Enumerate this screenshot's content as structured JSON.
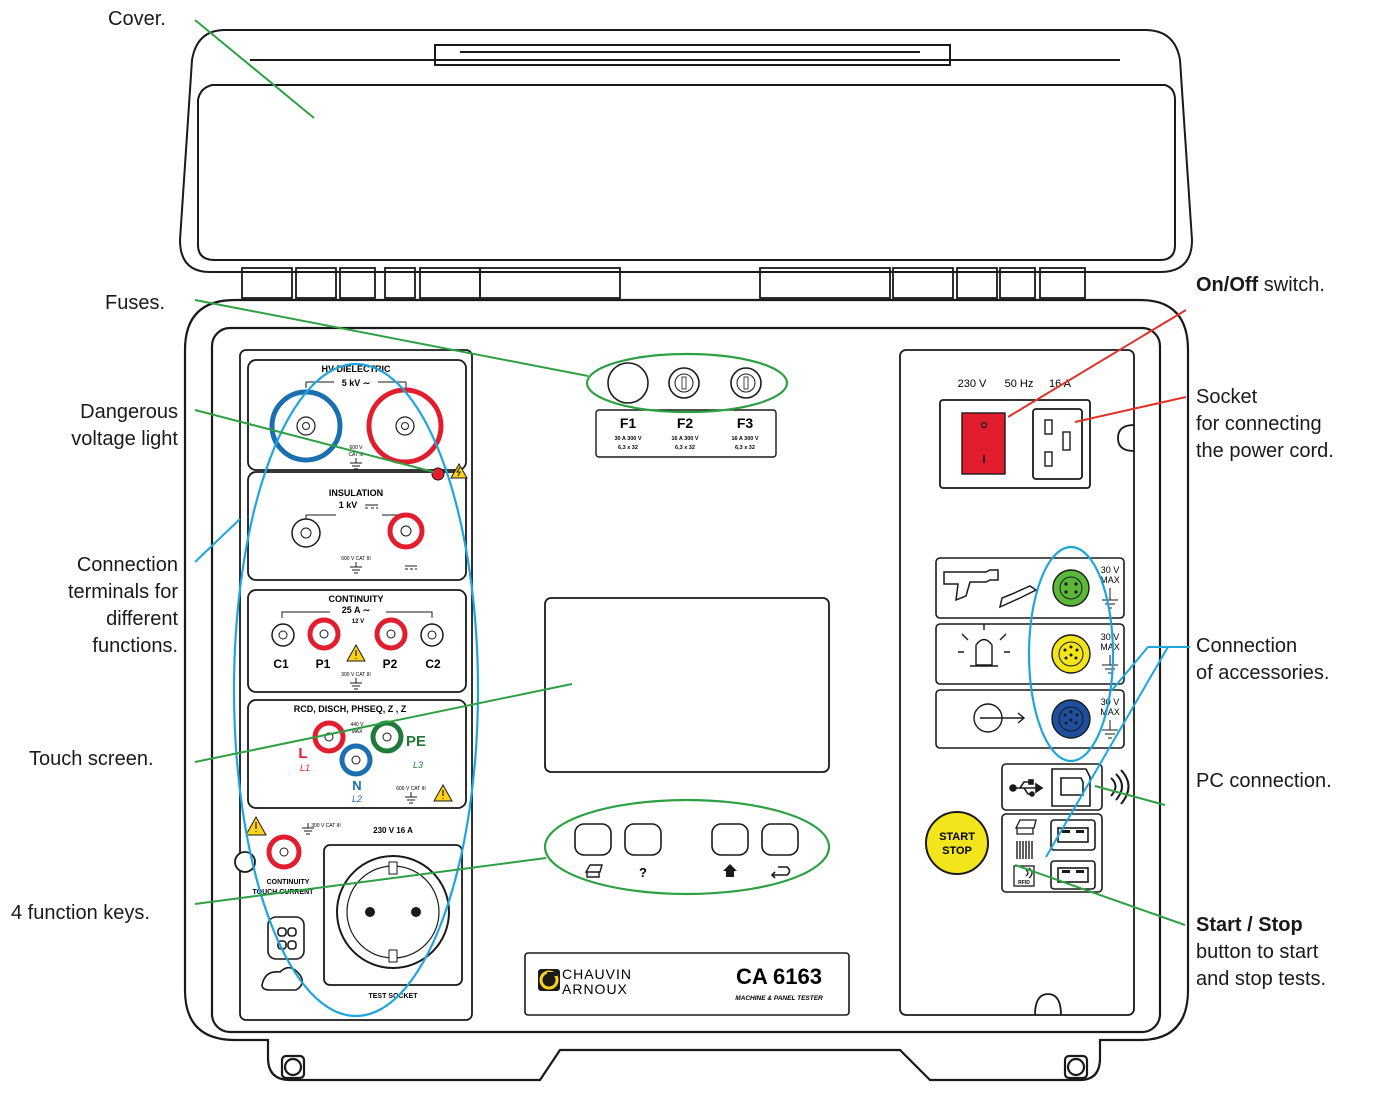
{
  "callouts": {
    "cover": "Cover.",
    "fuses": "Fuses.",
    "danger_1": "Dangerous",
    "danger_2": "voltage light",
    "terminals_1": "Connection",
    "terminals_2": "terminals for",
    "terminals_3": "different",
    "terminals_4": "functions.",
    "touch": "Touch screen.",
    "keys": "4 function keys.",
    "onoff_bold": "On/Off",
    "onoff_rest": " switch.",
    "socket_1": "Socket",
    "socket_2": "for connecting",
    "socket_3": "the power cord.",
    "acc_1": "Connection",
    "acc_2": "of accessories.",
    "pc": "PC connection.",
    "start_bold": "Start / Stop",
    "start_2": "button to start",
    "start_3": "and stop tests."
  },
  "panel": {
    "hv_title": "HV DIELECTRIC",
    "hv_sub": "5 kV ∼",
    "cat_600": "600 V",
    "cat_iii": "CAT III",
    "ins_title": "INSULATION",
    "ins_sub": "1 kV",
    "ins_cat": "600 V  CAT III",
    "cont_title": "CONTINUITY",
    "cont_sub": "25 A ∼",
    "cont_v": "12 V",
    "c1": "C1",
    "p1": "P1",
    "p2": "P2",
    "c2": "C2",
    "cont_cat": "300 V  CAT III",
    "rcd_title": "RCD, DISCH, PHSEQ, Z , Z",
    "rcd_max1": "440 V",
    "rcd_max2": "MAX",
    "l": "L",
    "l1": "L1",
    "n": "N",
    "l2": "L2",
    "pe": "PE",
    "l3": "L3",
    "rcd_cat": "600 V  CAT III",
    "ts_cat": "300 V  CAT III",
    "ts_rating": "230 V 16 A",
    "ts_cont1": "CONTINUITY",
    "ts_cont2": "TOUCH CURRENT",
    "test_socket": "TEST SOCKET",
    "f1": "F1",
    "f2": "F2",
    "f3": "F3",
    "f1_rating": "30 A  300 V",
    "f2_rating": "16 A  300 V",
    "f3_rating": "16 A  300 V",
    "fuse_size": "6,3 x 32",
    "key_help": "?",
    "brand_1": "CHAUVIN",
    "brand_2": "ARNOUX",
    "model": "CA 6163",
    "model_sub": "MACHINE & PANEL TESTER",
    "mains_v": "230 V",
    "mains_hz": "50 Hz",
    "mains_a": "16 A",
    "acc_v": "30 V",
    "acc_max": "MAX",
    "start": "START",
    "stop": "STOP",
    "rfid": "RFID"
  },
  "colors": {
    "outline": "#1a1a1a",
    "callout_green": "#2ea043",
    "callout_red": "#e0332b",
    "callout_blue": "#1ea6dc",
    "terminal_red": "#e11d2e",
    "terminal_blue": "#1a6fb0",
    "terminal_green": "#1f7a3a",
    "switch_red": "#e11d2e",
    "conn_green": "#5cb83a",
    "conn_yellow": "#f2e51b",
    "conn_blue": "#1d4f9e",
    "start_yellow": "#f2e51b",
    "warning_yellow": "#ffd21a"
  },
  "icons": [
    "warning-icon",
    "ground-icon",
    "usb-icon",
    "wifi-icon",
    "printer-icon",
    "home-icon",
    "back-icon",
    "scan-gun-icon",
    "lamp-icon",
    "barcode-icon",
    "rfid-icon",
    "chauvin-arnoux-logo"
  ]
}
